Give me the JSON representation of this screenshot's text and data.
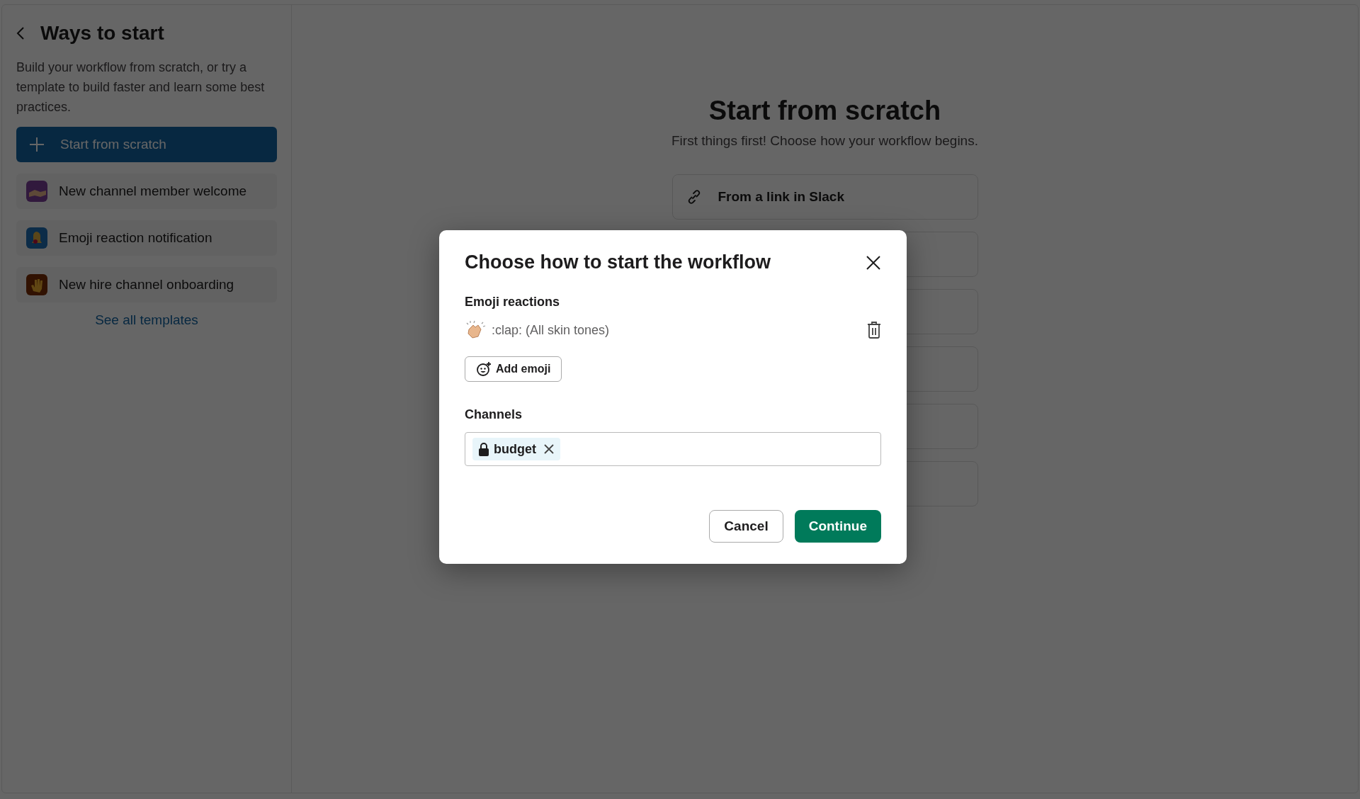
{
  "sidebar": {
    "title": "Ways to start",
    "description": "Build your workflow from scratch, or try a template to build faster and learn some best practices.",
    "items": [
      {
        "kind": "action",
        "label": "Start from scratch",
        "selected": true
      },
      {
        "kind": "template",
        "label": "New channel member welcome",
        "selected": false
      },
      {
        "kind": "template",
        "label": "Emoji reaction notification",
        "selected": false
      },
      {
        "kind": "template",
        "label": "New hire channel onboarding",
        "selected": false
      }
    ],
    "link": "See all templates"
  },
  "main": {
    "title": "Start from scratch",
    "subtitle": "First things first! Choose how your workflow begins.",
    "options": [
      {
        "label": "From a link in Slack"
      }
    ]
  },
  "dialog": {
    "title": "Choose how to start the workflow",
    "emoji_label": "Emoji reactions",
    "emojis": [
      {
        "name": ":clap: (All skin tones)"
      }
    ],
    "add_emoji": "Add emoji",
    "channels_label": "Channels",
    "channels": [
      {
        "name": "budget",
        "private": true
      }
    ],
    "cancel": "Cancel",
    "continue": "Continue"
  }
}
